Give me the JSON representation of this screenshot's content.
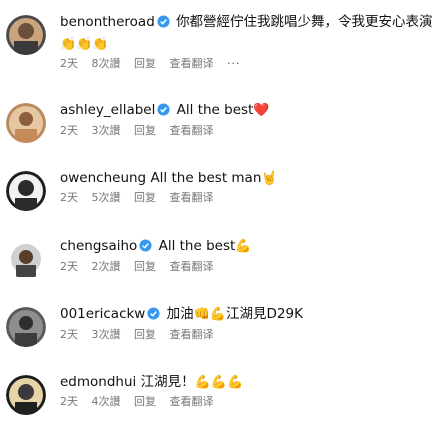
{
  "comments": [
    {
      "username": "benontheroad",
      "verified": true,
      "text": "你都營經佇住我跳唱少舞，令我更安心表演",
      "emoji_line": "👏👏👏",
      "time": "2天",
      "likes": "8次讚",
      "reply": "回复",
      "translate": "查看翻译",
      "more": "···"
    },
    {
      "username": "ashley_ellabel",
      "verified": true,
      "text": "All the best",
      "emoji": "❤️",
      "time": "2天",
      "likes": "3次讚",
      "reply": "回复",
      "translate": "查看翻译"
    },
    {
      "username": "owencheung",
      "verified": false,
      "text": "All the best man",
      "emoji": "🤘",
      "time": "2天",
      "likes": "5次讚",
      "reply": "回复",
      "translate": "查看翻译"
    },
    {
      "username": "chengsaiho",
      "verified": true,
      "text": "All the best",
      "emoji": "💪",
      "time": "2天",
      "likes": "2次讚",
      "reply": "回复",
      "translate": "查看翻译"
    },
    {
      "username": "001ericackw",
      "verified": true,
      "text_before": "加油",
      "emoji1": "👊",
      "emoji2": "💪",
      "text_after": "江湖見D29K",
      "time": "2天",
      "likes": "3次讚",
      "reply": "回复",
      "translate": "查看翻译"
    },
    {
      "username": "edmondhui",
      "verified": false,
      "text": "江湖見！",
      "emoji": "💪💪💪",
      "time": "2天",
      "likes": "4次讚",
      "reply": "回复",
      "translate": "查看翻译"
    }
  ],
  "colors": {
    "verified": "#3897f0",
    "meta": "#777777"
  }
}
